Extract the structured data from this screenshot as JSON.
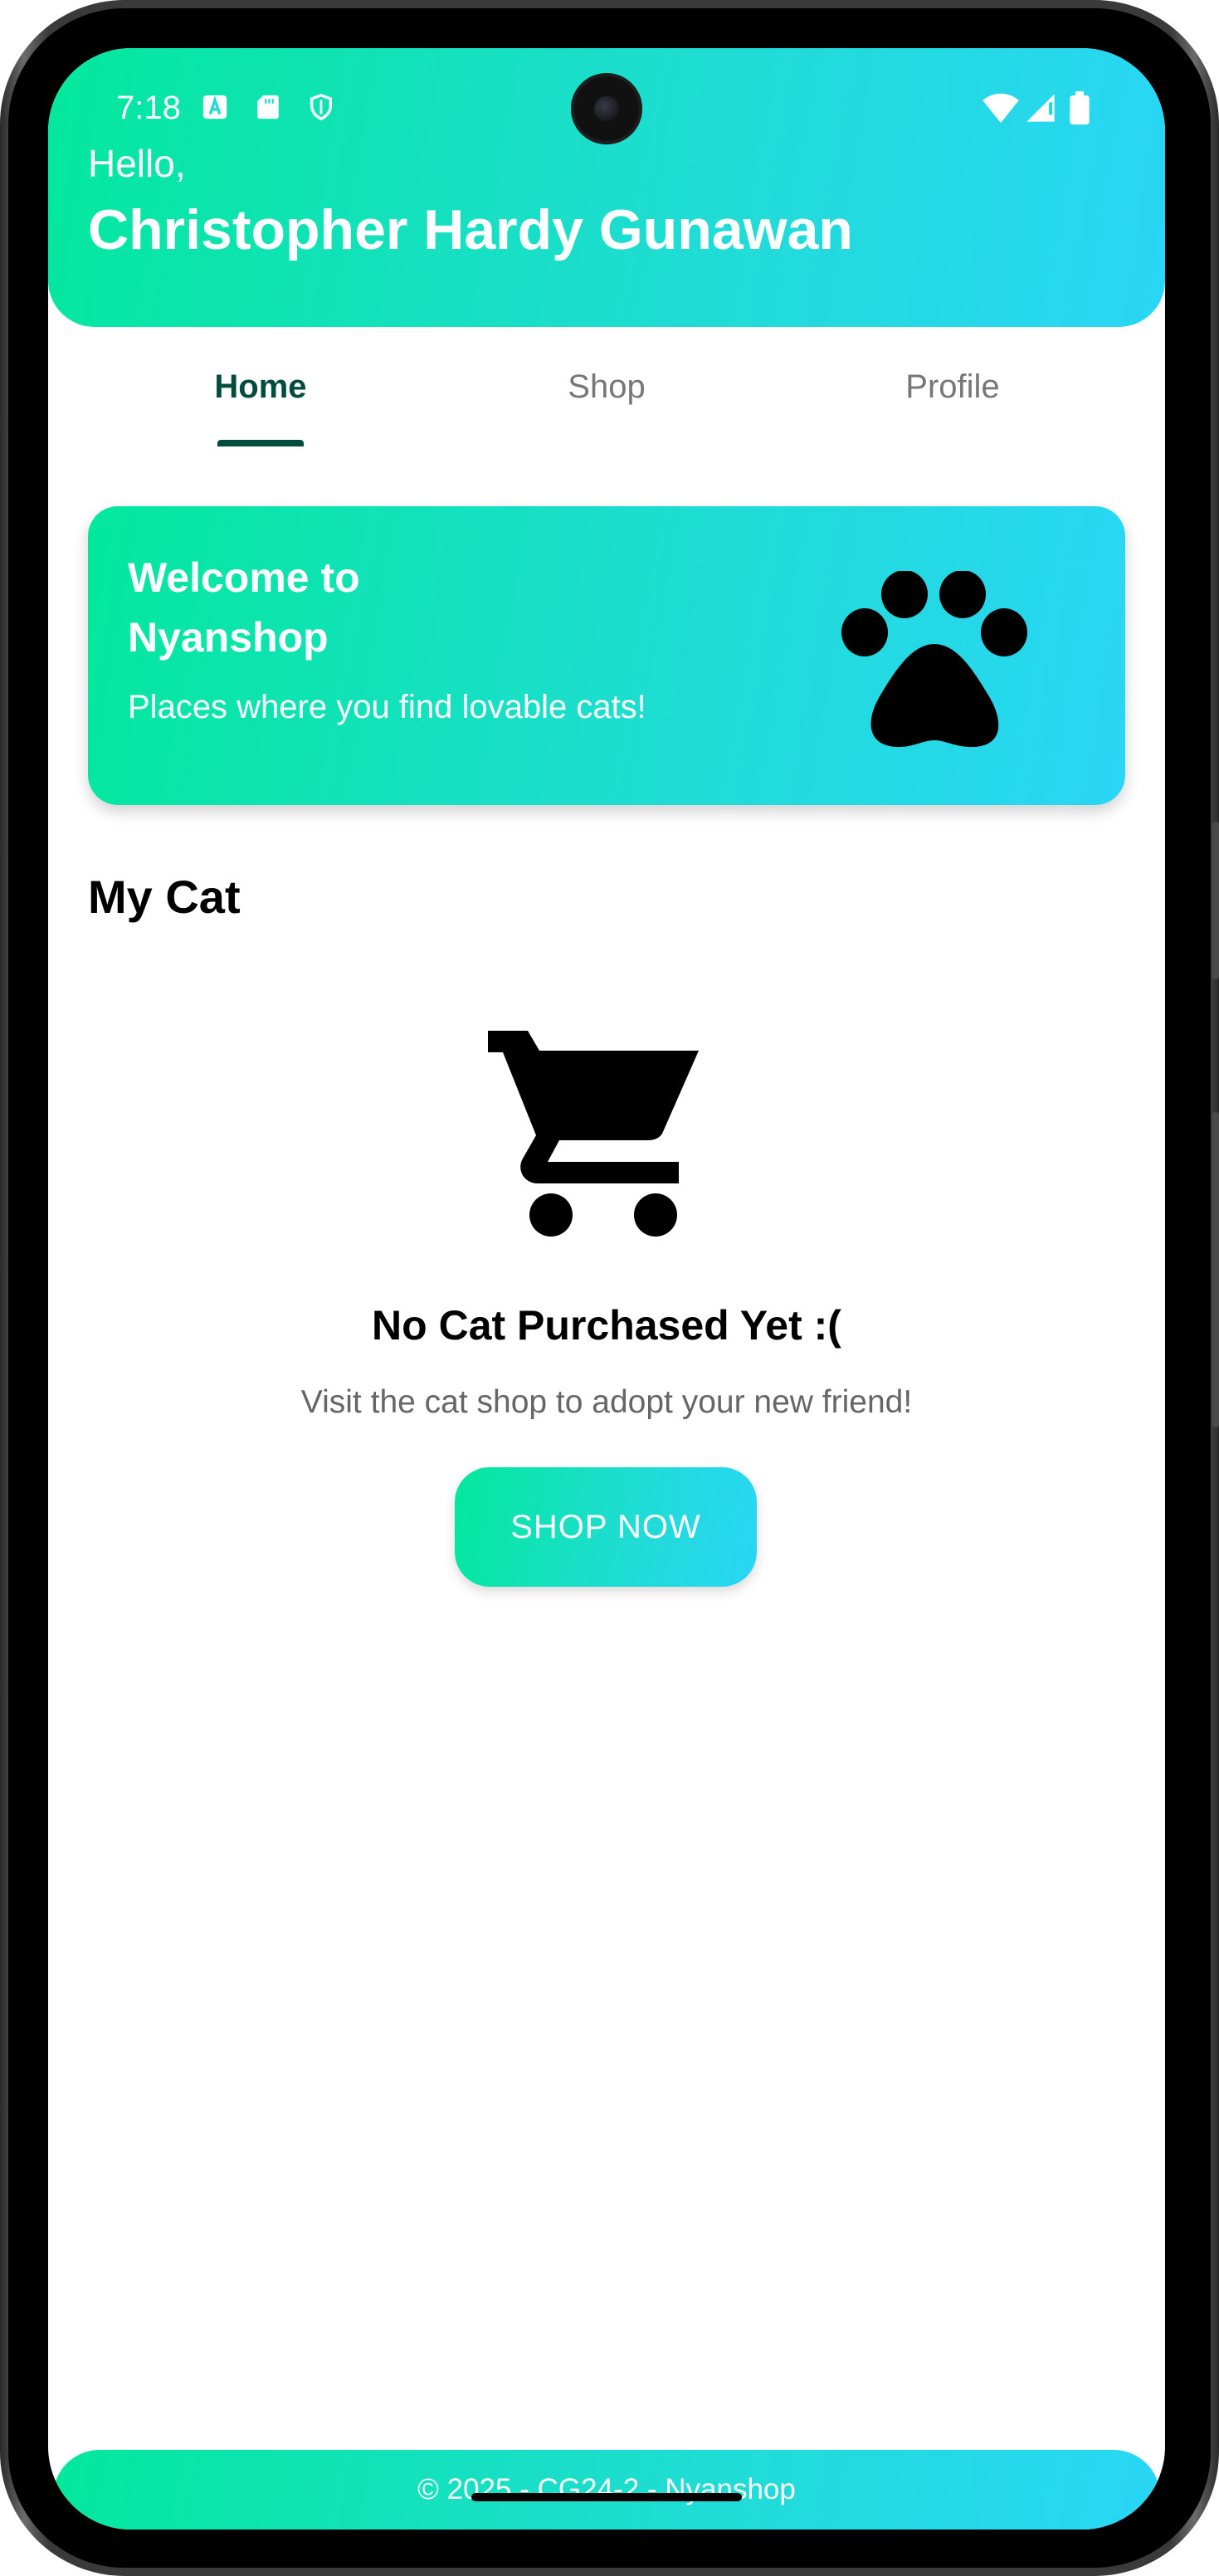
{
  "status_bar": {
    "time": "7:18",
    "left_icons": [
      "a-icon",
      "sd-card-icon",
      "shield-icon"
    ],
    "right_icons": [
      "wifi-icon",
      "signal-icon",
      "battery-icon"
    ]
  },
  "header": {
    "greeting": "Hello,",
    "user_name": "Christopher Hardy Gunawan"
  },
  "tabs": [
    {
      "label": "Home",
      "active": true
    },
    {
      "label": "Shop",
      "active": false
    },
    {
      "label": "Profile",
      "active": false
    }
  ],
  "welcome_card": {
    "title": "Welcome to Nyanshop",
    "subtitle": "Places where you find lovable cats!",
    "icon": "paw-icon"
  },
  "my_cat": {
    "section_title": "My Cat",
    "empty_icon": "shopping-cart-icon",
    "empty_title": "No Cat Purchased Yet :(",
    "empty_message": "Visit the cat shop to adopt your new friend!",
    "button_label": "SHOP NOW"
  },
  "footer": {
    "text": "© 2025 - CG24-2 - Nyanshop"
  },
  "colors": {
    "gradient_start": "#03e89c",
    "gradient_end": "#29d6f6",
    "tab_active": "#004d40",
    "tab_inactive": "#777777"
  }
}
